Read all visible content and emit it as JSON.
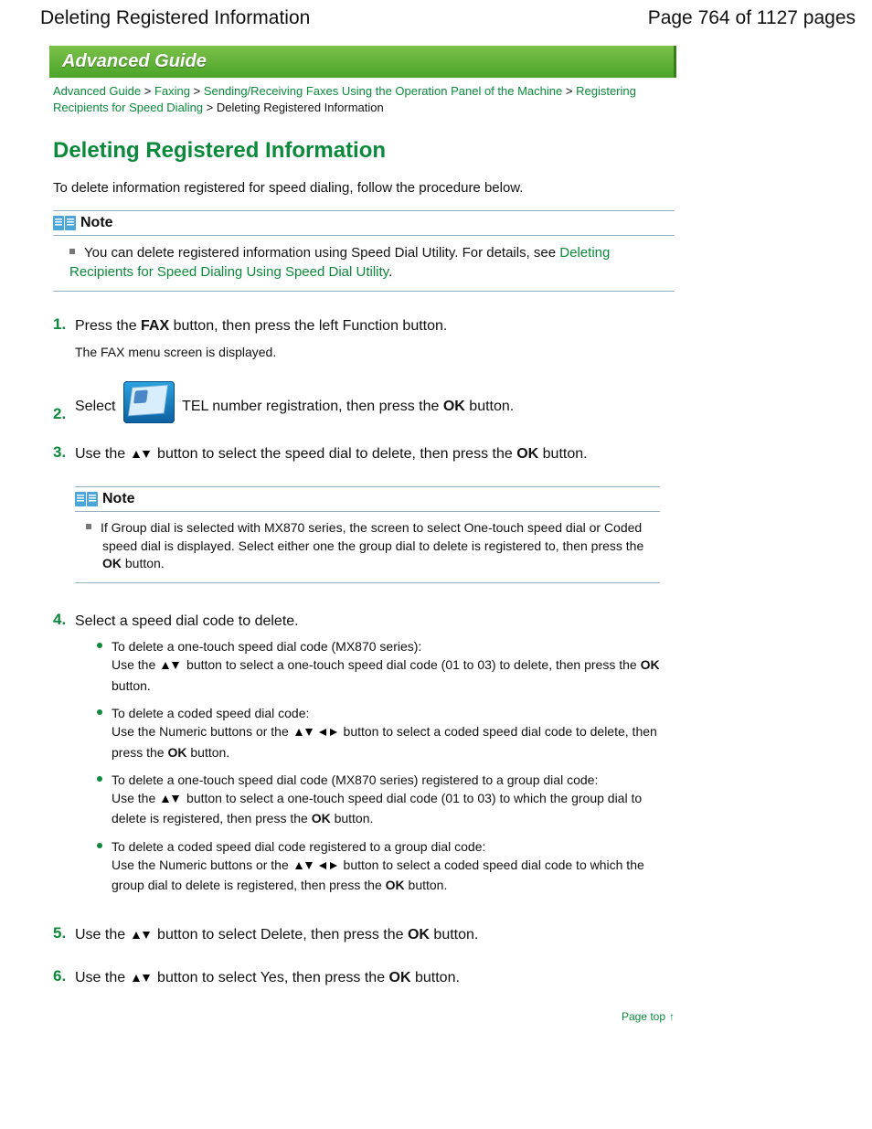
{
  "header": {
    "title": "Deleting Registered Information",
    "page_label": "Page 764 of 1127 pages"
  },
  "banner": "Advanced Guide",
  "crumbs": {
    "c1": "Advanced Guide",
    "c2": "Faxing",
    "c3": "Sending/Receiving Faxes Using the Operation Panel of the Machine",
    "c4": "Registering Recipients for Speed Dialing",
    "current": "Deleting Registered Information",
    "sep": " > "
  },
  "h1": "Deleting Registered Information",
  "intro": "To delete information registered for speed dialing, follow the procedure below.",
  "note1": {
    "label": "Note",
    "text_a": "You can delete registered information using Speed Dial Utility. For details, see ",
    "link": "Deleting Recipients for Speed Dialing Using Speed Dial Utility",
    "text_b": "."
  },
  "steps": {
    "s1": {
      "num": "1.",
      "a": "Press the ",
      "fax": "FAX",
      "b": " button, then press the left Function button.",
      "sub": "The FAX menu screen is displayed."
    },
    "s2": {
      "num": "2.",
      "a": "Select ",
      "b": " TEL number registration, then press the ",
      "ok": "OK",
      "c": " button."
    },
    "s3": {
      "num": "3.",
      "a": "Use the ",
      "b": " button to select the speed dial to delete, then press the ",
      "ok": "OK",
      "c": " button."
    },
    "note2": {
      "label": "Note",
      "a": "If Group dial is selected with MX870 series, the screen to select One-touch speed dial or Coded speed dial is displayed. Select either one the group dial to delete is registered to, then press the ",
      "ok": "OK",
      "b": " button."
    },
    "s4": {
      "num": "4.",
      "a": "Select a speed dial code to delete.",
      "bul1": {
        "t": "To delete a one-touch speed dial code (MX870 series):",
        "a": "Use the ",
        "b": " button to select a one-touch speed dial code (01 to 03) to delete, then press the ",
        "ok": "OK",
        "c": " button."
      },
      "bul2": {
        "t": "To delete a coded speed dial code:",
        "a": "Use the Numeric buttons or the ",
        "b": " button to select a coded speed dial code to delete, then press the ",
        "ok": "OK",
        "c": " button."
      },
      "bul3": {
        "t": "To delete a one-touch speed dial code (MX870 series) registered to a group dial code:",
        "a": "Use the ",
        "b": " button to select a one-touch speed dial code (01 to 03) to which the group dial to delete is registered, then press the ",
        "ok": "OK",
        "c": " button."
      },
      "bul4": {
        "t": "To delete a coded speed dial code registered to a group dial code:",
        "a": "Use the Numeric buttons or the ",
        "b": " button to select a coded speed dial code to which the group dial to delete is registered, then press the ",
        "ok": "OK",
        "c": " button."
      }
    },
    "s5": {
      "num": "5.",
      "a": "Use the ",
      "b": " button to select Delete, then press the ",
      "ok": "OK",
      "c": " button."
    },
    "s6": {
      "num": "6.",
      "a": "Use the ",
      "b": " button to select Yes, then press the ",
      "ok": "OK",
      "c": " button."
    }
  },
  "pagetop": "Page top"
}
